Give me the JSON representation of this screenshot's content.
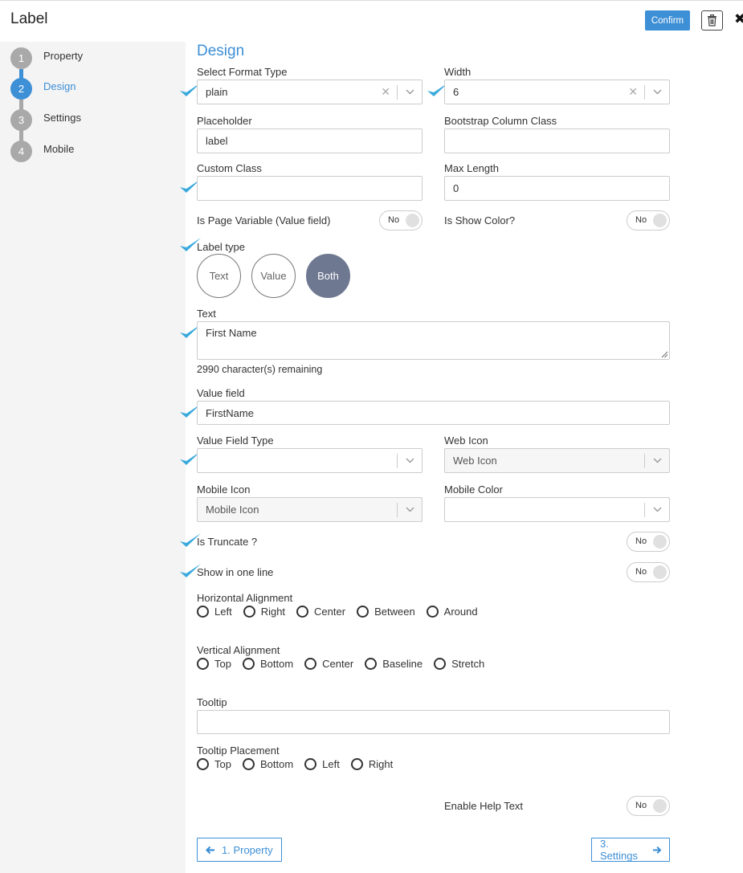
{
  "header": {
    "title": "Label",
    "confirm_label": "Confirm"
  },
  "sidebar": {
    "steps": [
      {
        "number": "1",
        "label": "Property",
        "active": false
      },
      {
        "number": "2",
        "label": "Design",
        "active": true
      },
      {
        "number": "3",
        "label": "Settings",
        "active": false
      },
      {
        "number": "4",
        "label": "Mobile",
        "active": false
      }
    ]
  },
  "design": {
    "section_title": "Design",
    "format_type": {
      "label": "Select Format Type",
      "value": "plain"
    },
    "width": {
      "label": "Width",
      "value": "6"
    },
    "placeholder": {
      "label": "Placeholder",
      "value": "label"
    },
    "bootstrap_class": {
      "label": "Bootstrap Column Class",
      "value": ""
    },
    "custom_class": {
      "label": "Custom Class",
      "value": ""
    },
    "max_length": {
      "label": "Max Length",
      "value": "0"
    },
    "is_page_variable": {
      "label": "Is Page Variable (Value field)",
      "state": "No"
    },
    "is_show_color": {
      "label": "Is Show Color?",
      "state": "No"
    },
    "label_type": {
      "label": "Label type",
      "options": [
        "Text",
        "Value",
        "Both"
      ],
      "selected": "Both"
    },
    "text": {
      "label": "Text",
      "value": "First Name",
      "remaining": "2990 character(s) remaining"
    },
    "value_field": {
      "label": "Value field",
      "value": "FirstName"
    },
    "value_field_type": {
      "label": "Value Field Type",
      "value": ""
    },
    "web_icon": {
      "label": "Web Icon",
      "placeholder": "Web Icon"
    },
    "mobile_icon": {
      "label": "Mobile Icon",
      "placeholder": "Mobile Icon"
    },
    "mobile_color": {
      "label": "Mobile Color",
      "value": ""
    },
    "is_truncate": {
      "label": "Is Truncate ?",
      "state": "No"
    },
    "show_one_line": {
      "label": "Show in one line",
      "state": "No"
    },
    "horizontal_alignment": {
      "label": "Horizontal Alignment",
      "options": [
        "Left",
        "Right",
        "Center",
        "Between",
        "Around"
      ]
    },
    "vertical_alignment": {
      "label": "Vertical Alignment",
      "options": [
        "Top",
        "Bottom",
        "Center",
        "Baseline",
        "Stretch"
      ]
    },
    "tooltip": {
      "label": "Tooltip",
      "value": ""
    },
    "tooltip_placement": {
      "label": "Tooltip Placement",
      "options": [
        "Top",
        "Bottom",
        "Left",
        "Right"
      ]
    },
    "enable_help_text": {
      "label": "Enable Help Text",
      "state": "No"
    }
  },
  "footer": {
    "prev_label": "1. Property",
    "next_label": "3. Settings"
  },
  "colors": {
    "accent": "#3d8fd6",
    "check": "#39a9dc",
    "selected_pill": "#6e7891"
  }
}
